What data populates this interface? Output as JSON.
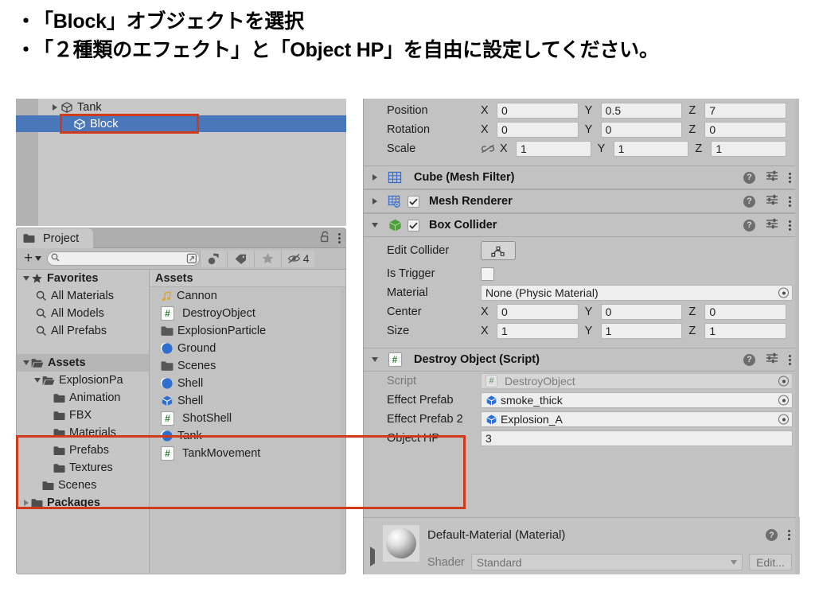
{
  "slide": {
    "bullets": [
      {
        "dot": "・",
        "text": "「Block」オブジェクトを選択"
      },
      {
        "dot": "・",
        "text": "「２種類のエフェクト」と「Object HP」を自由に設定してください。"
      }
    ]
  },
  "colors": {
    "selection_blue": "#4a76ba",
    "annotation_red": "#d03a1c",
    "panel_gray": "#c2c2c2",
    "script_green": "#2f7d32",
    "prefab_blue": "#3e7fd4"
  },
  "hierarchy": {
    "rows": [
      {
        "label": "Tank",
        "icon": "gameobject-cube-icon",
        "expandable": true,
        "selected": false
      },
      {
        "label": "Block",
        "icon": "gameobject-cube-icon",
        "expandable": false,
        "selected": true
      }
    ]
  },
  "project": {
    "tab_label": "Project",
    "tab_icon": "folder-icon",
    "lock_icon": "lock-open-icon",
    "menu_icon": "kebab-menu-icon",
    "toolbar": {
      "create_label": "+",
      "search_value": "",
      "search_placeholder": "",
      "search_icon": "search-icon",
      "fold_icon": "collapse-icon",
      "filter_type_icon": "filter-type-icon",
      "filter_label_icon": "label-tag-icon",
      "favorites_icon": "star-icon",
      "hidden_icon": "eye-off-icon",
      "hidden_count": "4"
    },
    "tree": [
      {
        "label": "Favorites",
        "icon": "star-icon",
        "depth": 0,
        "fold": "down",
        "bold": true
      },
      {
        "label": "All Materials",
        "icon": "search-icon",
        "depth": 1,
        "fold": "none",
        "bold": false
      },
      {
        "label": "All Models",
        "icon": "search-icon",
        "depth": 1,
        "fold": "none",
        "bold": false
      },
      {
        "label": "All Prefabs",
        "icon": "search-icon",
        "depth": 1,
        "fold": "none",
        "bold": false
      },
      {
        "label": "",
        "icon": "spacer",
        "depth": 0,
        "fold": "none",
        "bold": false
      },
      {
        "label": "Assets",
        "icon": "folder-open-icon",
        "depth": 0,
        "fold": "down",
        "bold": true,
        "selected": true
      },
      {
        "label": "ExplosionPa",
        "icon": "folder-open-icon",
        "depth": 1,
        "fold": "down",
        "bold": false
      },
      {
        "label": "Animation",
        "icon": "folder-icon",
        "depth": 2,
        "fold": "none",
        "bold": false
      },
      {
        "label": "FBX",
        "icon": "folder-icon",
        "depth": 2,
        "fold": "none",
        "bold": false
      },
      {
        "label": "Materials",
        "icon": "folder-icon",
        "depth": 2,
        "fold": "none",
        "bold": false
      },
      {
        "label": "Prefabs",
        "icon": "folder-icon",
        "depth": 2,
        "fold": "none",
        "bold": false
      },
      {
        "label": "Textures",
        "icon": "folder-icon",
        "depth": 2,
        "fold": "none",
        "bold": false
      },
      {
        "label": "Scenes",
        "icon": "folder-icon",
        "depth": 1,
        "fold": "none",
        "bold": false
      },
      {
        "label": "Packages",
        "icon": "folder-icon",
        "depth": 0,
        "fold": "right",
        "bold": true
      }
    ],
    "assets_header": "Assets",
    "assets": [
      {
        "label": "Cannon",
        "icon": "audio-clip-icon"
      },
      {
        "label": "DestroyObject",
        "icon": "cs-script-icon"
      },
      {
        "label": "ExplosionParticle",
        "icon": "folder-icon"
      },
      {
        "label": "Ground",
        "icon": "material-icon"
      },
      {
        "label": "Scenes",
        "icon": "folder-icon"
      },
      {
        "label": "Shell",
        "icon": "material-icon"
      },
      {
        "label": "Shell",
        "icon": "prefab-icon"
      },
      {
        "label": "ShotShell",
        "icon": "cs-script-icon"
      },
      {
        "label": "Tank",
        "icon": "material-icon"
      },
      {
        "label": "TankMovement",
        "icon": "cs-script-icon"
      }
    ]
  },
  "inspector": {
    "transform": {
      "rows": [
        {
          "label": "Position",
          "link_icon": false,
          "values": [
            {
              "axis": "X",
              "value": "0"
            },
            {
              "axis": "Y",
              "value": "0.5"
            },
            {
              "axis": "Z",
              "value": "7"
            }
          ]
        },
        {
          "label": "Rotation",
          "link_icon": false,
          "values": [
            {
              "axis": "X",
              "value": "0"
            },
            {
              "axis": "Y",
              "value": "0"
            },
            {
              "axis": "Z",
              "value": "0"
            }
          ]
        },
        {
          "label": "Scale",
          "link_icon": true,
          "link_icon_name": "link-broken-icon",
          "values": [
            {
              "axis": "X",
              "value": "1"
            },
            {
              "axis": "Y",
              "value": "1"
            },
            {
              "axis": "Z",
              "value": "1"
            }
          ]
        }
      ]
    },
    "components": [
      {
        "title": "Cube (Mesh Filter)",
        "icon": "mesh-filter-icon",
        "fold": "right",
        "has_checkbox": false,
        "checked": false
      },
      {
        "title": "Mesh Renderer",
        "icon": "mesh-renderer-icon",
        "fold": "right",
        "has_checkbox": true,
        "checked": true
      },
      {
        "title": "Box Collider",
        "icon": "box-collider-icon",
        "fold": "down",
        "has_checkbox": true,
        "checked": true
      }
    ],
    "box_collider": {
      "edit_collider_label": "Edit Collider",
      "edit_collider_icon": "edit-collider-icon",
      "is_trigger_label": "Is Trigger",
      "is_trigger_checked": false,
      "material_label": "Material",
      "material_value": "None (Physic Material)",
      "center_label": "Center",
      "center": [
        {
          "axis": "X",
          "value": "0"
        },
        {
          "axis": "Y",
          "value": "0"
        },
        {
          "axis": "Z",
          "value": "0"
        }
      ],
      "size_label": "Size",
      "size": [
        {
          "axis": "X",
          "value": "1"
        },
        {
          "axis": "Y",
          "value": "1"
        },
        {
          "axis": "Z",
          "value": "1"
        }
      ]
    },
    "destroy_object": {
      "title": "Destroy Object (Script)",
      "icon": "cs-script-icon",
      "fold": "down",
      "script_label": "Script",
      "script_value": "DestroyObject",
      "fields": [
        {
          "label": "Effect Prefab",
          "value": "smoke_thick",
          "icon": "prefab-icon",
          "type": "object"
        },
        {
          "label": "Effect Prefab 2",
          "value": "Explosion_A",
          "icon": "prefab-icon",
          "type": "object"
        },
        {
          "label": "Object HP",
          "value": "3",
          "icon": "",
          "type": "number"
        }
      ]
    },
    "material_footer": {
      "title": "Default-Material (Material)",
      "preview_icon": "material-sphere-preview",
      "shader_label": "Shader",
      "shader_value": "Standard",
      "edit_label": "Edit...",
      "help_icon": "help-icon",
      "menu_icon": "kebab-menu-icon"
    },
    "header_tools": {
      "help_icon": "help-icon",
      "preset_icon": "preset-icon",
      "menu_icon": "kebab-menu-icon"
    }
  },
  "annotations": [
    {
      "name": "hierarchy-block-highlight",
      "color": "#d03a1c"
    },
    {
      "name": "destroy-object-fields-highlight",
      "color": "#d03a1c"
    }
  ]
}
